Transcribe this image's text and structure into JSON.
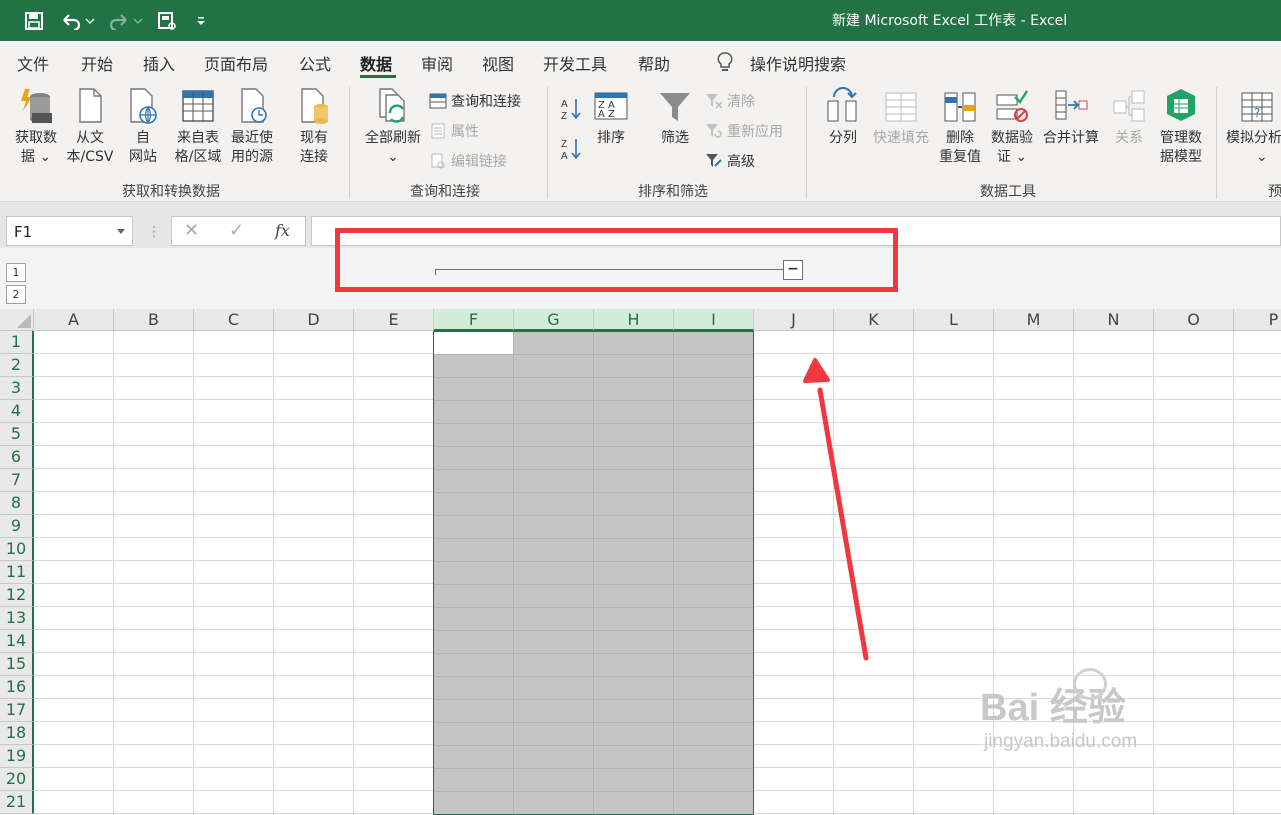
{
  "window": {
    "title": "新建 Microsoft Excel 工作表  -  Excel"
  },
  "quick_access": [
    "save-icon",
    "undo-icon",
    "redo-icon",
    "print-preview-icon",
    "customize-qat-icon"
  ],
  "menu": {
    "tabs": [
      "文件",
      "开始",
      "插入",
      "页面布局",
      "公式",
      "数据",
      "审阅",
      "视图",
      "开发工具",
      "帮助"
    ],
    "active": "数据",
    "search_label": "操作说明搜索"
  },
  "ribbon": {
    "get_data": {
      "l1": "获取数",
      "l2": "据 ⌄"
    },
    "from_text": {
      "l1": "从文",
      "l2": "本/CSV"
    },
    "from_web": {
      "l1": "自",
      "l2": "网站"
    },
    "from_table": {
      "l1": "来自表",
      "l2": "格/区域"
    },
    "recent_sources": {
      "l1": "最近使",
      "l2": "用的源"
    },
    "existing_conn": {
      "l1": "现有",
      "l2": "连接"
    },
    "group1": "获取和转换数据",
    "refresh_all": {
      "l1": "全部刷新",
      "l2": "⌄"
    },
    "queries_connections": "查询和连接",
    "properties": "属性",
    "edit_links": "编辑链接",
    "group2": "查询和连接",
    "sort": "排序",
    "filter": "筛选",
    "clear": "清除",
    "reapply": "重新应用",
    "advanced": "高级",
    "group3": "排序和筛选",
    "text_to_columns": "分列",
    "flash_fill": "快速填充",
    "remove_dup": {
      "l1": "删除",
      "l2": "重复值"
    },
    "data_validation": {
      "l1": "数据验",
      "l2": "证 ⌄"
    },
    "consolidate": "合并计算",
    "relationships": "关系",
    "manage_model": {
      "l1": "管理数",
      "l2": "据模型"
    },
    "group4": "数据工具",
    "what_if": {
      "l1": "模拟分析",
      "l2": "⌄"
    },
    "group5": "预"
  },
  "formula_bar": {
    "name_box": "F1",
    "fx": "fx"
  },
  "outline": {
    "levels": [
      "1",
      "2"
    ],
    "collapse_label": "−"
  },
  "columns": [
    "A",
    "B",
    "C",
    "D",
    "E",
    "F",
    "G",
    "H",
    "I",
    "J",
    "K",
    "L",
    "M",
    "N",
    "O",
    "P"
  ],
  "selected_columns": [
    "F",
    "G",
    "H",
    "I"
  ],
  "rows": [
    "1",
    "2",
    "3",
    "4",
    "5",
    "6",
    "7",
    "8",
    "9",
    "10",
    "11",
    "12",
    "13",
    "14",
    "15",
    "16",
    "17",
    "18",
    "19",
    "20",
    "21"
  ],
  "colors": {
    "accent": "#217346",
    "annotation": "#f0393e",
    "selection": "#c4c4c4"
  },
  "watermark": {
    "brand": "Bai 经验",
    "url": "jingyan.baidu.com"
  }
}
